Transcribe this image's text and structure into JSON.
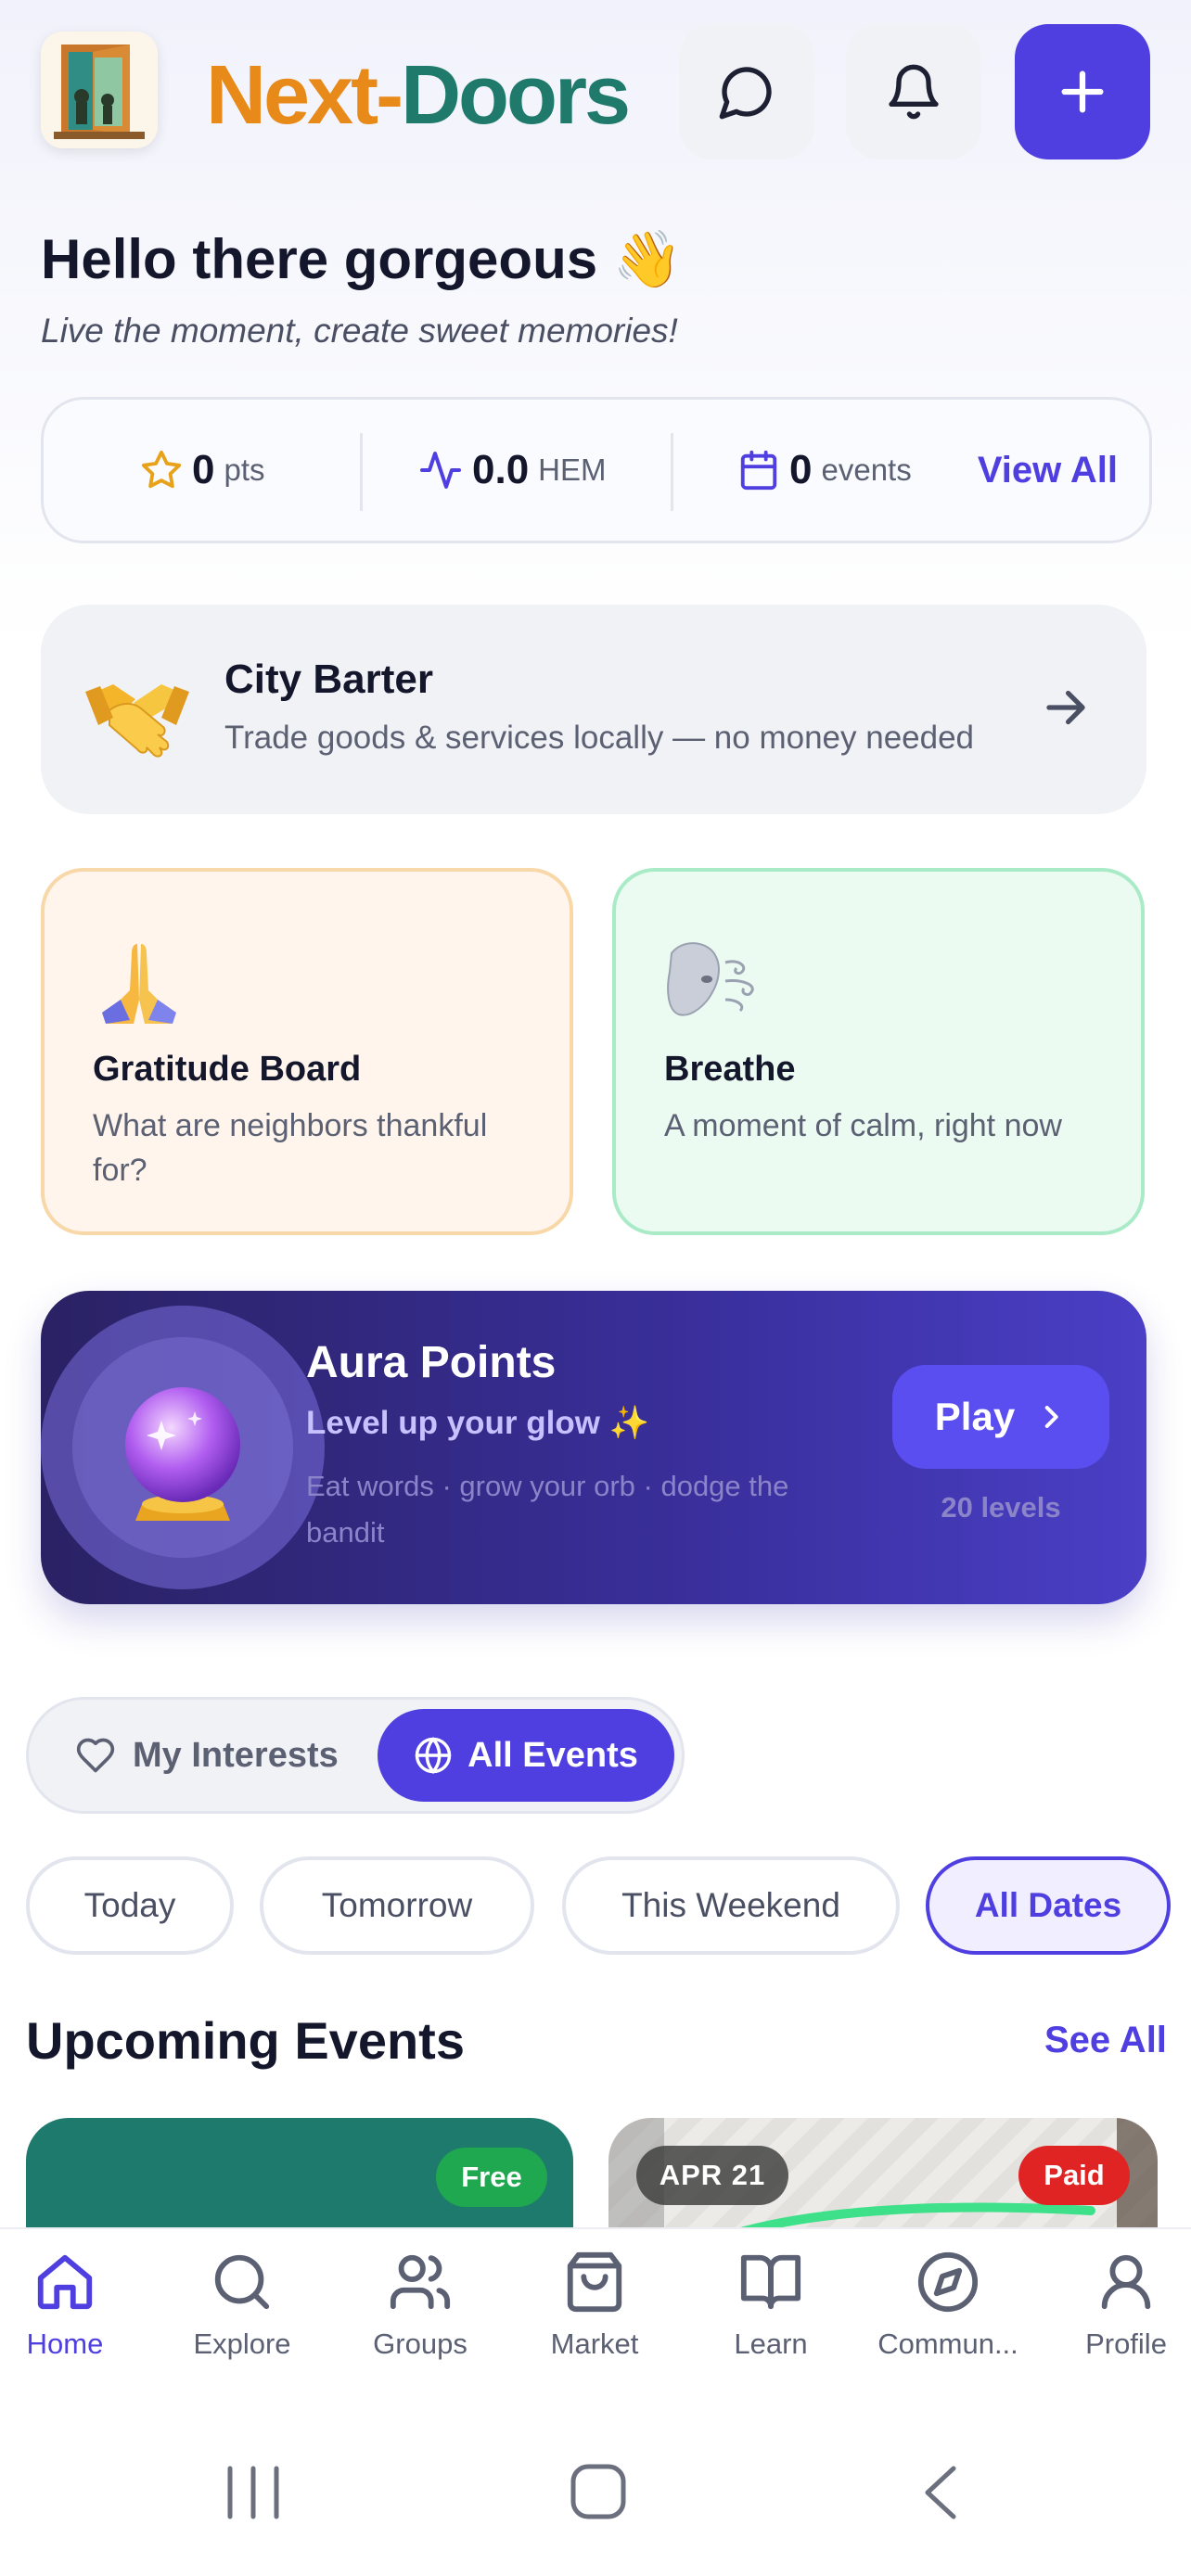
{
  "header": {
    "app_name_part1": "Next",
    "app_name_dash": "-",
    "app_name_part2": "Doors",
    "icons": [
      "door-logo",
      "chat-icon",
      "bell-icon",
      "plus-icon"
    ]
  },
  "greeting": {
    "title": "Hello there gorgeous 👋",
    "subtitle": "Live the moment, create sweet memories!"
  },
  "stats": {
    "points_value": "0",
    "points_unit": "pts",
    "hem_value": "0.0",
    "hem_unit": "HEM",
    "events_value": "0",
    "events_unit": "events",
    "view_all": "View All"
  },
  "barter": {
    "emoji": "🤝",
    "title": "City Barter",
    "subtitle": "Trade goods & services locally — no money needed"
  },
  "cards": [
    {
      "emoji": "🙏",
      "title": "Gratitude Board",
      "subtitle": "What are neighbors thankful for?"
    },
    {
      "emoji": "🌬️",
      "title": "Breathe",
      "subtitle": "A moment of calm, right now"
    }
  ],
  "aura": {
    "emoji": "🔮",
    "title": "Aura Points",
    "tagline": "Level up your glow ✨",
    "description": "Eat words · grow your orb · dodge the bandit",
    "play_label": "Play",
    "levels": "20 levels"
  },
  "toggle": {
    "left_label": "My Interests",
    "right_label": "All Events",
    "selected": "All Events"
  },
  "chips": [
    "Today",
    "Tomorrow",
    "This Weekend",
    "All Dates"
  ],
  "chips_selected": "All Dates",
  "upcoming": {
    "title": "Upcoming Events",
    "see_all": "See All",
    "events": [
      {
        "badge": "Free",
        "badge_color": "#1fa84f"
      },
      {
        "date": "APR 21",
        "badge": "Paid",
        "badge_color": "#e02424"
      }
    ]
  },
  "nav": {
    "items": [
      {
        "label": "Home",
        "icon": "home-icon"
      },
      {
        "label": "Explore",
        "icon": "search-icon"
      },
      {
        "label": "Groups",
        "icon": "users-icon"
      },
      {
        "label": "Market",
        "icon": "shopping-bag-icon"
      },
      {
        "label": "Learn",
        "icon": "book-icon"
      },
      {
        "label": "Commun...",
        "icon": "compass-icon"
      },
      {
        "label": "Profile",
        "icon": "user-icon"
      }
    ],
    "active": "Home"
  },
  "colors": {
    "accent": "#4f3fe0",
    "brand_orange": "#e88a1a",
    "brand_teal": "#1f7a6c",
    "free": "#1fa84f",
    "paid": "#e02424"
  }
}
